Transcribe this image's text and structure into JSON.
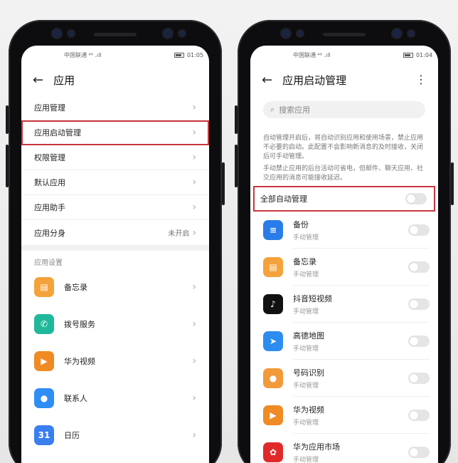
{
  "left": {
    "status": {
      "carrier": "中国联通 ⁴⁶ .ıll",
      "time": "01:05"
    },
    "title": "应用",
    "menu": [
      {
        "label": "应用管理",
        "state": ""
      },
      {
        "label": "应用启动管理",
        "state": ""
      },
      {
        "label": "权限管理",
        "state": ""
      },
      {
        "label": "默认应用",
        "state": ""
      },
      {
        "label": "应用助手",
        "state": ""
      },
      {
        "label": "应用分身",
        "state": "未开启"
      }
    ],
    "section_label": "应用设置",
    "apps": [
      {
        "name": "备忘录",
        "color": "#f4a23a",
        "glyph": "▤"
      },
      {
        "name": "拨号服务",
        "color": "#1fb89a",
        "glyph": "✆"
      },
      {
        "name": "华为视频",
        "color": "#f08a24",
        "glyph": "▶"
      },
      {
        "name": "联系人",
        "color": "#2f8ef5",
        "glyph": "👤"
      },
      {
        "name": "日历",
        "color": "#3a7ef0",
        "glyph": "31"
      }
    ]
  },
  "right": {
    "status": {
      "carrier": "中国联通 ⁴⁶ .ıll",
      "time": "01:04"
    },
    "title": "应用启动管理",
    "search_placeholder": "搜索应用",
    "desc1": "自动管理开启后，将自动识别应用和使用场景，禁止应用不必要的启动。此配置不会影响新消息的及时接收，关闭后可手动管理。",
    "desc2": "手动禁止应用的后台活动可省电，但邮件、聊天应用、社交应用的消息可能接收延迟。",
    "all_label": "全部自动管理",
    "apps": [
      {
        "name": "备份",
        "sub": "手动管理",
        "color": "#2a7de8",
        "glyph": "≡"
      },
      {
        "name": "备忘录",
        "sub": "手动管理",
        "color": "#f4a23a",
        "glyph": "▤"
      },
      {
        "name": "抖音短视频",
        "sub": "手动管理",
        "color": "#111111",
        "glyph": "♪"
      },
      {
        "name": "高德地图",
        "sub": "手动管理",
        "color": "#2d8cf0",
        "glyph": "➤"
      },
      {
        "name": "号码识别",
        "sub": "手动管理",
        "color": "#f29a3a",
        "glyph": "👤"
      },
      {
        "name": "华为视频",
        "sub": "手动管理",
        "color": "#f08a24",
        "glyph": "▶"
      },
      {
        "name": "华为应用市场",
        "sub": "手动管理",
        "color": "#e02a2a",
        "glyph": "✿"
      }
    ]
  }
}
